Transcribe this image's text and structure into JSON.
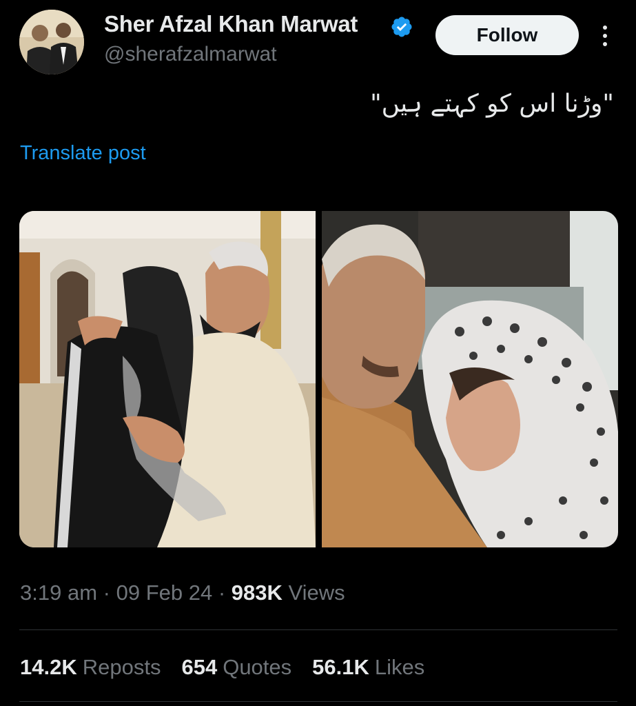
{
  "header": {
    "display_name": "Sher Afzal Khan Marwat",
    "handle": "@sherafzalmarwat",
    "follow_label": "Follow"
  },
  "post": {
    "text": "\"وڑنا اس کو کہتے ہیں\"",
    "translate_label": "Translate post"
  },
  "meta": {
    "time": "3:19 am",
    "date": "09 Feb 24",
    "views_count": "983K",
    "views_label": "Views",
    "separator": "·"
  },
  "stats": {
    "reposts_count": "14.2K",
    "reposts_label": "Reposts",
    "quotes_count": "654",
    "quotes_label": "Quotes",
    "likes_count": "56.1K",
    "likes_label": "Likes"
  },
  "colors": {
    "background": "#000000",
    "link": "#1d9bf0",
    "verified": "#1d9bf0",
    "secondary_text": "#71767b",
    "primary_text": "#e7e9ea"
  },
  "icons": [
    "verified-badge-icon",
    "more-options-icon"
  ]
}
